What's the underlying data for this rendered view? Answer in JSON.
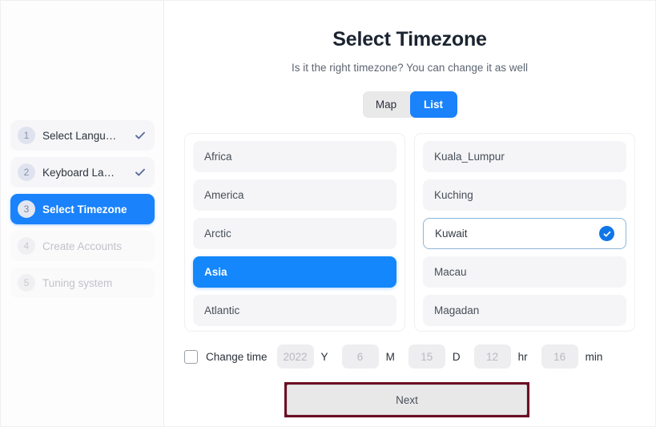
{
  "sidebar": {
    "items": [
      {
        "number": "1",
        "label": "Select Langu…",
        "state": "done"
      },
      {
        "number": "2",
        "label": "Keyboard La…",
        "state": "done"
      },
      {
        "number": "3",
        "label": "Select Timezone",
        "state": "active"
      },
      {
        "number": "4",
        "label": "Create Accounts",
        "state": "pending"
      },
      {
        "number": "5",
        "label": "Tuning system",
        "state": "pending"
      }
    ]
  },
  "main": {
    "title": "Select Timezone",
    "subtitle": "Is it the right timezone? You can change it as well",
    "view_toggle": {
      "map_label": "Map",
      "list_label": "List",
      "active": "List"
    },
    "regions": [
      {
        "label": "Africa",
        "selected": false
      },
      {
        "label": "America",
        "selected": false
      },
      {
        "label": "Arctic",
        "selected": false
      },
      {
        "label": "Asia",
        "selected": true
      },
      {
        "label": "Atlantic",
        "selected": false
      }
    ],
    "cities": [
      {
        "label": "Kuala_Lumpur",
        "selected": false
      },
      {
        "label": "Kuching",
        "selected": false
      },
      {
        "label": "Kuwait",
        "selected": true
      },
      {
        "label": "Macau",
        "selected": false
      },
      {
        "label": "Magadan",
        "selected": false
      }
    ],
    "change_time": {
      "checkbox_label": "Change time",
      "checked": false,
      "fields": [
        {
          "value": "2022",
          "unit": "Y"
        },
        {
          "value": "6",
          "unit": "M"
        },
        {
          "value": "15",
          "unit": "D"
        },
        {
          "value": "12",
          "unit": "hr"
        },
        {
          "value": "16",
          "unit": "min"
        }
      ]
    },
    "next_label": "Next"
  },
  "colors": {
    "accent_blue": "#1a82fb",
    "selected_blue": "#1387fb",
    "check_badge_blue": "#1076e8",
    "highlight_maroon": "#6b0f22",
    "item_grey": "#f5f5f7",
    "field_grey": "#eeeef0",
    "selected_border": "#8cb6d8"
  }
}
